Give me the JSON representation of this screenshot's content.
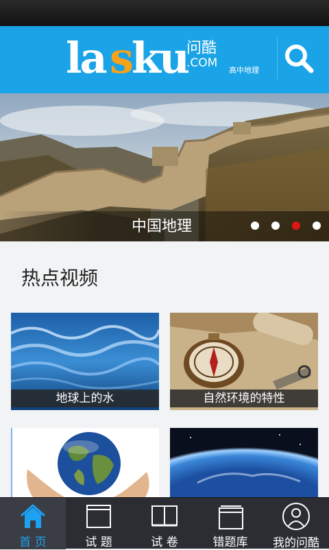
{
  "header": {
    "logo_main": "lasku",
    "logo_cn": "问酷",
    "logo_com": ".COM",
    "subject": "高中地理"
  },
  "banner": {
    "title": "中国地理",
    "dots": [
      false,
      false,
      true,
      false
    ],
    "active_dot_color": "#e01616"
  },
  "hot_videos": {
    "title": "热点视频",
    "items": [
      {
        "label": "地球上的水"
      },
      {
        "label": "自然环境的特性"
      },
      {
        "label": ""
      },
      {
        "label": ""
      }
    ]
  },
  "bottom_nav": {
    "items": [
      {
        "label": "首 页",
        "icon": "home-icon",
        "active": true
      },
      {
        "label": "试 题",
        "icon": "questions-icon",
        "active": false
      },
      {
        "label": "试 卷",
        "icon": "exam-paper-icon",
        "active": false
      },
      {
        "label": "错题库",
        "icon": "wrong-questions-icon",
        "active": false
      },
      {
        "label": "我的问酷",
        "icon": "profile-icon",
        "active": false
      }
    ]
  },
  "colors": {
    "header": "#1aa3e6",
    "accent_orange": "#f7a21b",
    "nav_bg": "#2b2d33",
    "nav_active_text": "#1da1f2"
  }
}
